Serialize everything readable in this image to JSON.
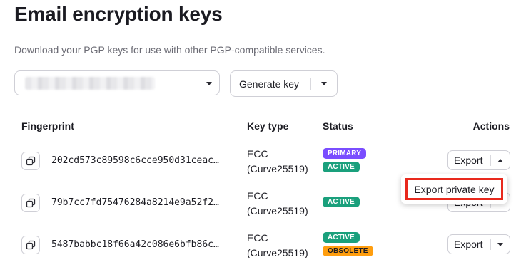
{
  "page": {
    "title": "Email encryption keys",
    "subtitle": "Download your PGP keys for use with other PGP-compatible services."
  },
  "controls": {
    "generate_label": "Generate key"
  },
  "table": {
    "headers": {
      "fingerprint": "Fingerprint",
      "key_type": "Key type",
      "status": "Status",
      "actions": "Actions"
    },
    "rows": [
      {
        "fingerprint": "202cd573c89598c6cce950d31ceac…",
        "key_type_line1": "ECC",
        "key_type_line2": "(Curve25519)",
        "status_1": "PRIMARY",
        "status_2": "ACTIVE",
        "export_label": "Export"
      },
      {
        "fingerprint": "79b7cc7fd75476284a8214e9a52f2…",
        "key_type_line1": "ECC",
        "key_type_line2": "(Curve25519)",
        "status_1": "ACTIVE",
        "export_label": "Export"
      },
      {
        "fingerprint": "5487babbc18f66a42c086e6bfb86c…",
        "key_type_line1": "ECC",
        "key_type_line2": "(Curve25519)",
        "status_1": "ACTIVE",
        "status_2": "OBSOLETE",
        "export_label": "Export"
      }
    ]
  },
  "dropdown": {
    "item": "Export private key"
  },
  "colors": {
    "primary_badge": "#7a4dff",
    "active_badge": "#1aa07c",
    "obsolete_badge": "#ff9e0f",
    "highlight": "#e8291d"
  },
  "icons": [
    "copy-icon",
    "chevron-down-icon",
    "chevron-up-icon"
  ]
}
